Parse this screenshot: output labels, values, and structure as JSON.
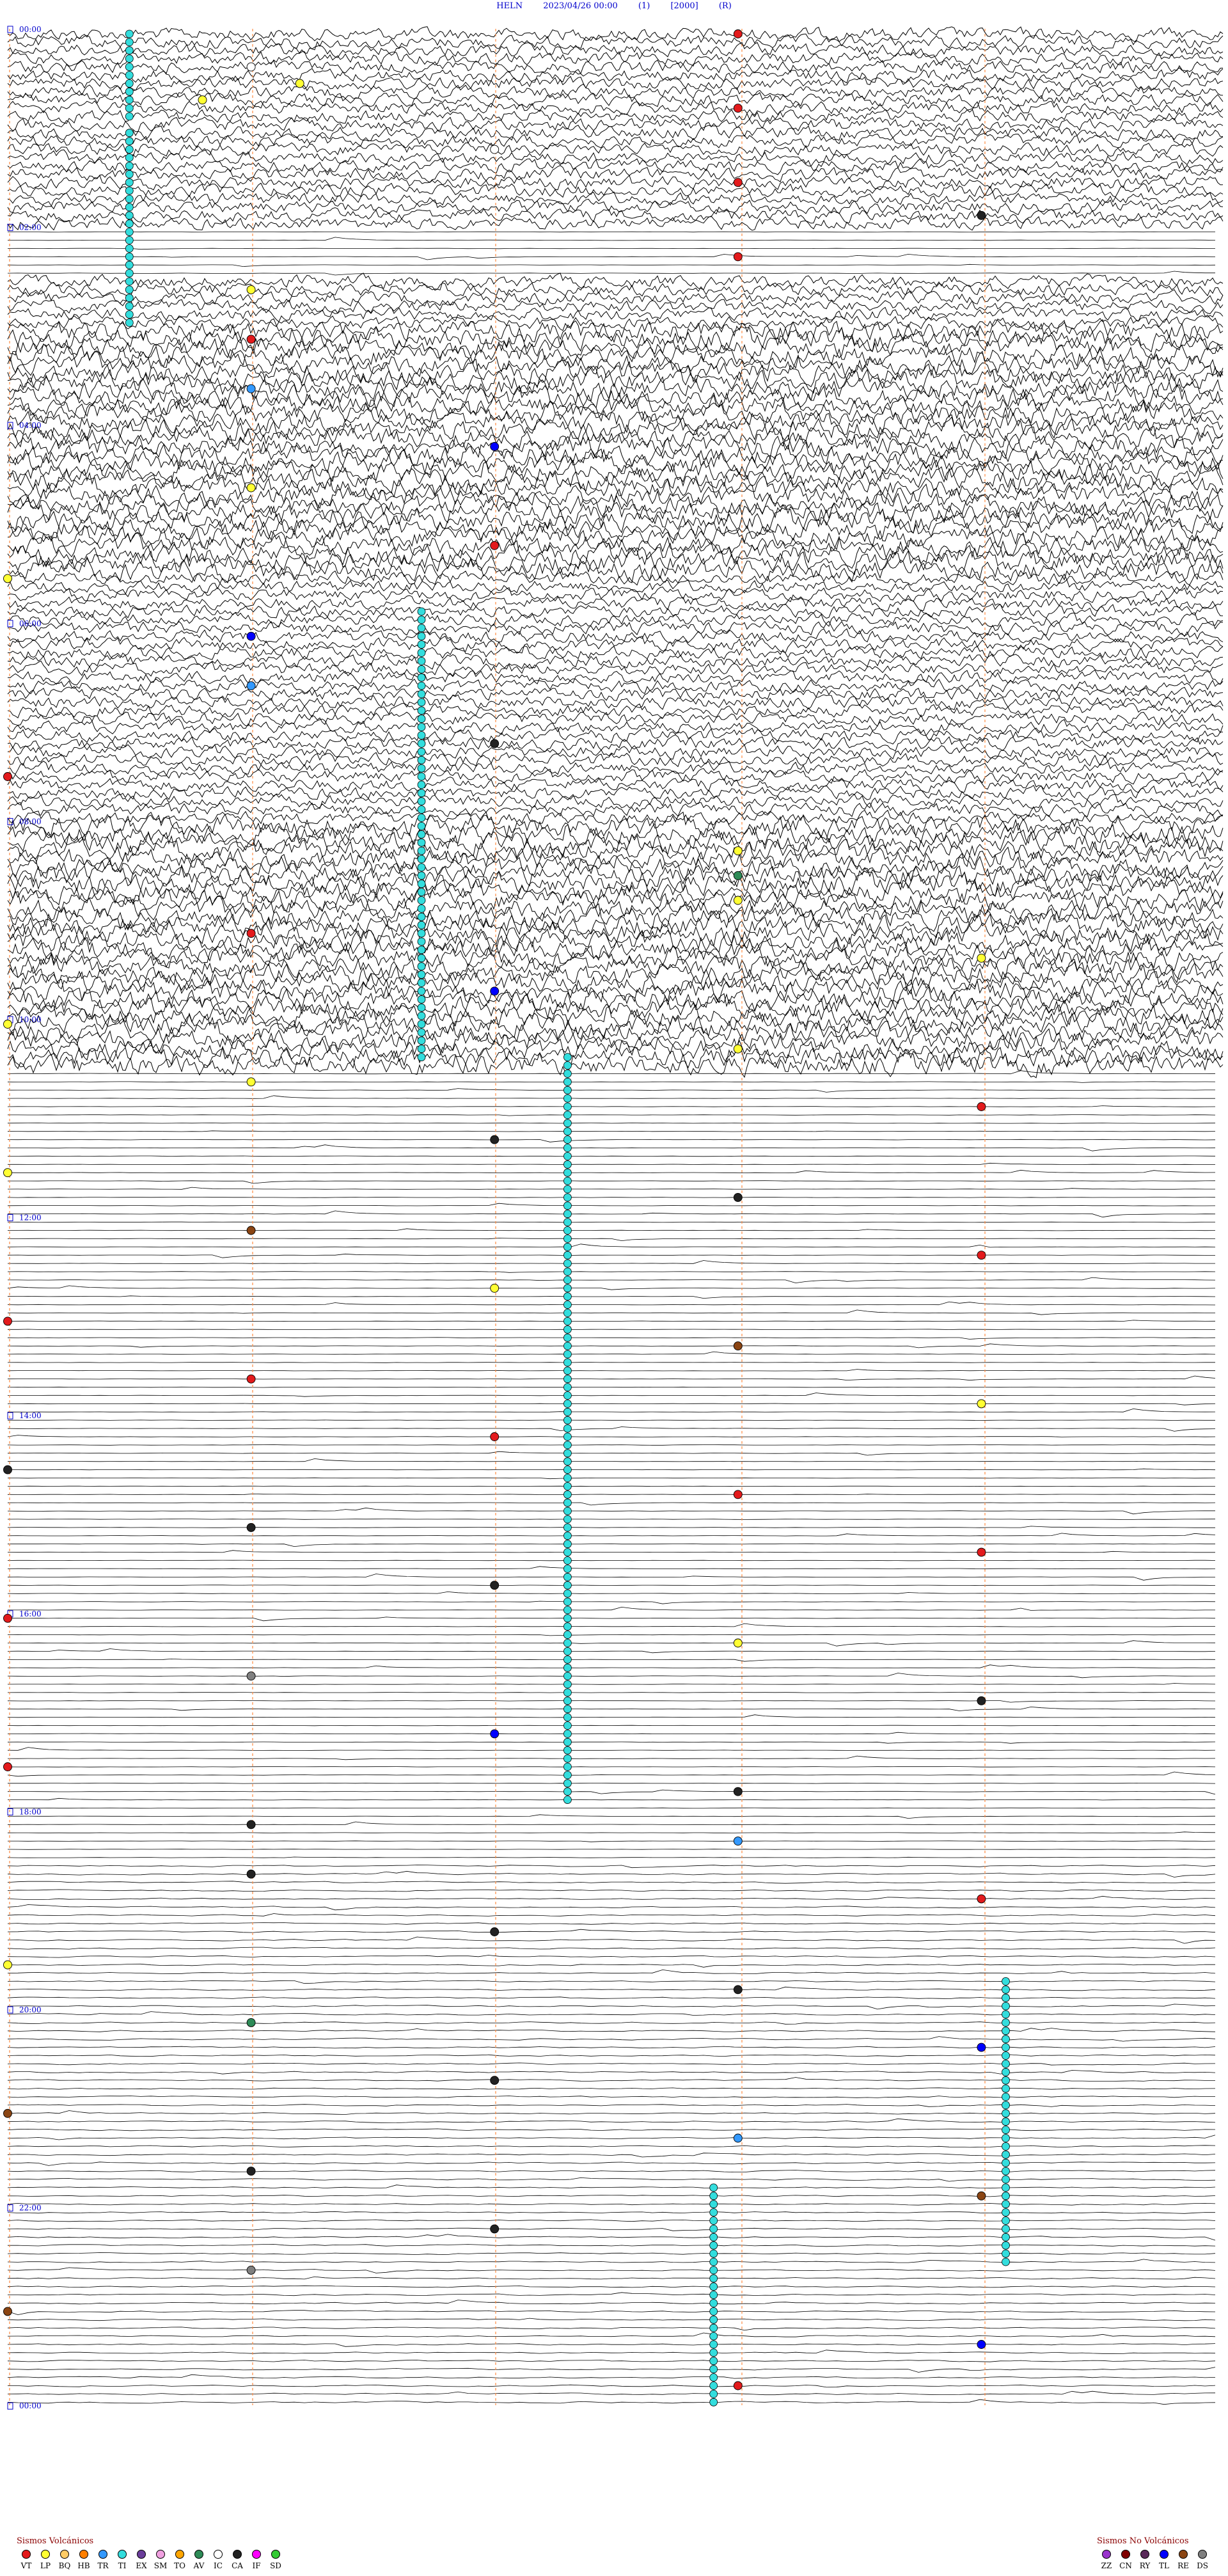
{
  "header": {
    "station": "HELN",
    "date": "2023/04/26 00:00",
    "scale": "(1)",
    "gain": "[2000]",
    "flag": "(R)"
  },
  "chart_data": {
    "type": "helicorder",
    "title": "HELN 2023/04/26 00:00 (1) [2000] (R)",
    "hour_labels": [
      "00:00",
      "02:00",
      "04:00",
      "06:00",
      "08:00",
      "10:00",
      "12:00",
      "14:00",
      "16:00",
      "18:00",
      "20:00",
      "22:00",
      "00:00"
    ],
    "noisy_hours": [
      [
        0,
        2
      ],
      [
        2.5,
        10.5
      ]
    ],
    "very_noisy_hours": [
      [
        3,
        5.5
      ],
      [
        8,
        10.5
      ]
    ],
    "light_hours": [
      [
        18.5,
        24
      ]
    ],
    "markers": [
      {
        "t": 0.05,
        "cls": "VT"
      },
      {
        "t": 0.35,
        "cls": "IC"
      },
      {
        "t": 0.52,
        "cls": "LP"
      },
      {
        "t": 0.68,
        "cls": "LP"
      },
      {
        "t": 0.8,
        "cls": "VT"
      },
      {
        "t": 1.2,
        "cls": "IC"
      },
      {
        "t": 1.55,
        "cls": "VT"
      },
      {
        "t": 1.9,
        "cls": "CA"
      },
      {
        "t": 2.3,
        "cls": "VT"
      },
      {
        "t": 2.6,
        "cls": "LP"
      },
      {
        "t": 3.1,
        "cls": "VT"
      },
      {
        "t": 3.6,
        "cls": "TR"
      },
      {
        "t": 4.2,
        "cls": "TL"
      },
      {
        "t": 4.6,
        "cls": "LP"
      },
      {
        "t": 5.2,
        "cls": "VT"
      },
      {
        "t": 5.5,
        "cls": "LP"
      },
      {
        "t": 6.1,
        "cls": "TL"
      },
      {
        "t": 6.6,
        "cls": "TR"
      },
      {
        "t": 7.2,
        "cls": "CA"
      },
      {
        "t": 7.5,
        "cls": "VT"
      },
      {
        "t": 8.3,
        "cls": "LP"
      },
      {
        "t": 8.55,
        "cls": "AV"
      },
      {
        "t": 8.8,
        "cls": "LP"
      },
      {
        "t": 9.1,
        "cls": "VT"
      },
      {
        "t": 9.4,
        "cls": "LP"
      },
      {
        "t": 9.7,
        "cls": "TL"
      },
      {
        "t": 10.0,
        "cls": "LP"
      },
      {
        "t": 10.3,
        "cls": "LP"
      },
      {
        "t": 10.6,
        "cls": "LP"
      },
      {
        "t": 10.9,
        "cls": "VT"
      },
      {
        "t": 11.2,
        "cls": "CA"
      },
      {
        "t": 11.5,
        "cls": "LP"
      },
      {
        "t": 11.8,
        "cls": "CA"
      },
      {
        "t": 12.1,
        "cls": "RE"
      },
      {
        "t": 12.4,
        "cls": "VT"
      },
      {
        "t": 12.7,
        "cls": "LP"
      },
      {
        "t": 13.0,
        "cls": "VT"
      },
      {
        "t": 13.3,
        "cls": "RE"
      },
      {
        "t": 13.6,
        "cls": "VT"
      },
      {
        "t": 13.9,
        "cls": "LP"
      },
      {
        "t": 14.2,
        "cls": "VT"
      },
      {
        "t": 14.5,
        "cls": "CA"
      },
      {
        "t": 14.8,
        "cls": "VT"
      },
      {
        "t": 15.1,
        "cls": "CA"
      },
      {
        "t": 15.4,
        "cls": "VT"
      },
      {
        "t": 15.7,
        "cls": "CA"
      },
      {
        "t": 16.0,
        "cls": "VT"
      },
      {
        "t": 16.3,
        "cls": "LP"
      },
      {
        "t": 16.6,
        "cls": "DS"
      },
      {
        "t": 16.9,
        "cls": "CA"
      },
      {
        "t": 17.2,
        "cls": "TL"
      },
      {
        "t": 17.5,
        "cls": "VT"
      },
      {
        "t": 17.8,
        "cls": "CA"
      },
      {
        "t": 18.1,
        "cls": "CA"
      },
      {
        "t": 18.3,
        "cls": "TR"
      },
      {
        "t": 18.6,
        "cls": "CA"
      },
      {
        "t": 18.9,
        "cls": "VT"
      },
      {
        "t": 19.2,
        "cls": "CA"
      },
      {
        "t": 19.5,
        "cls": "LP"
      },
      {
        "t": 19.8,
        "cls": "CA"
      },
      {
        "t": 20.1,
        "cls": "AV"
      },
      {
        "t": 20.4,
        "cls": "TL"
      },
      {
        "t": 20.7,
        "cls": "CA"
      },
      {
        "t": 21.0,
        "cls": "RE"
      },
      {
        "t": 21.3,
        "cls": "TR"
      },
      {
        "t": 21.6,
        "cls": "CA"
      },
      {
        "t": 21.9,
        "cls": "RE"
      },
      {
        "t": 22.2,
        "cls": "CA"
      },
      {
        "t": 22.6,
        "cls": "DS"
      },
      {
        "t": 23.0,
        "cls": "RE"
      },
      {
        "t": 23.4,
        "cls": "TL"
      },
      {
        "t": 23.8,
        "cls": "VT"
      }
    ],
    "ti_runs": [
      {
        "start": 0.0,
        "end": 0.9
      },
      {
        "start": 1.0,
        "end": 2.95
      },
      {
        "start": 5.9,
        "end": 10.4
      },
      {
        "start": 10.35,
        "end": 17.9
      },
      {
        "start": 19.7,
        "end": 22.5
      },
      {
        "start": 21.8,
        "end": 24.0
      }
    ]
  },
  "legend_volcanic": {
    "title": "Sismos Volcánicos",
    "items": [
      {
        "code": "VT",
        "color": "#e31a1c"
      },
      {
        "code": "LP",
        "color": "#ffff33"
      },
      {
        "code": "BQ",
        "color": "#ffcc66"
      },
      {
        "code": "HB",
        "color": "#ff7f00"
      },
      {
        "code": "TR",
        "color": "#3399ff"
      },
      {
        "code": "TI",
        "color": "#33dddd"
      },
      {
        "code": "EX",
        "color": "#6a3d9a"
      },
      {
        "code": "SM",
        "color": "#f0a0e0"
      },
      {
        "code": "TO",
        "color": "#ffa500"
      },
      {
        "code": "AV",
        "color": "#2e8b57"
      },
      {
        "code": "IC",
        "color": "#ffffff"
      },
      {
        "code": "CA",
        "color": "#222222"
      },
      {
        "code": "IF",
        "color": "#ff00ff"
      },
      {
        "code": "SD",
        "color": "#33cc33"
      }
    ]
  },
  "legend_nonvolcanic": {
    "title": "Sismos No Volcánicos",
    "items": [
      {
        "code": "ZZ",
        "color": "#9933cc"
      },
      {
        "code": "CN",
        "color": "#800000"
      },
      {
        "code": "RY",
        "color": "#5a2a5a"
      },
      {
        "code": "TL",
        "color": "#0000ff"
      },
      {
        "code": "RE",
        "color": "#8b4513"
      },
      {
        "code": "DS",
        "color": "#808080"
      }
    ]
  }
}
